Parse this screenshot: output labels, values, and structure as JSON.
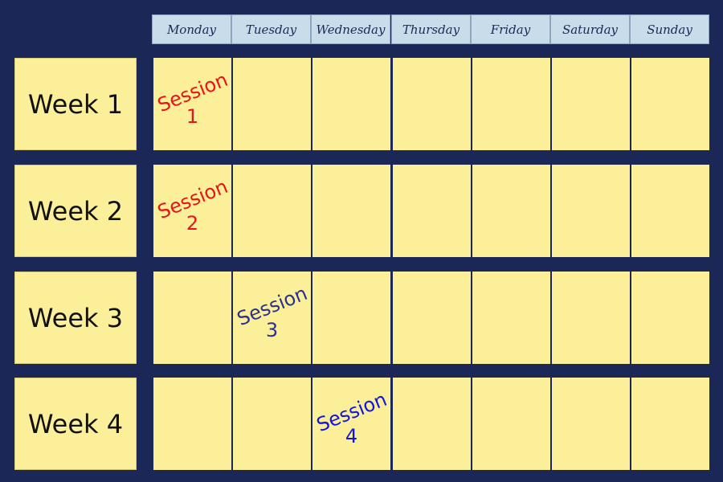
{
  "days": [
    "Monday",
    "Tuesday",
    "Wednesday",
    "Thursday",
    "Friday",
    "Saturday",
    "Sunday"
  ],
  "weeks": [
    "Week 1",
    "Week 2",
    "Week 3",
    "Week 4"
  ],
  "sessions": [
    {
      "word": "Session",
      "number": "1",
      "week": 0,
      "day": 0,
      "color": "#e8141a"
    },
    {
      "word": "Session",
      "number": "2",
      "week": 1,
      "day": 0,
      "color": "#e8141a"
    },
    {
      "word": "Session",
      "number": "3",
      "week": 2,
      "day": 1,
      "color": "#2a3190"
    },
    {
      "word": "Session",
      "number": "4",
      "week": 3,
      "day": 2,
      "color": "#1414e0"
    }
  ]
}
